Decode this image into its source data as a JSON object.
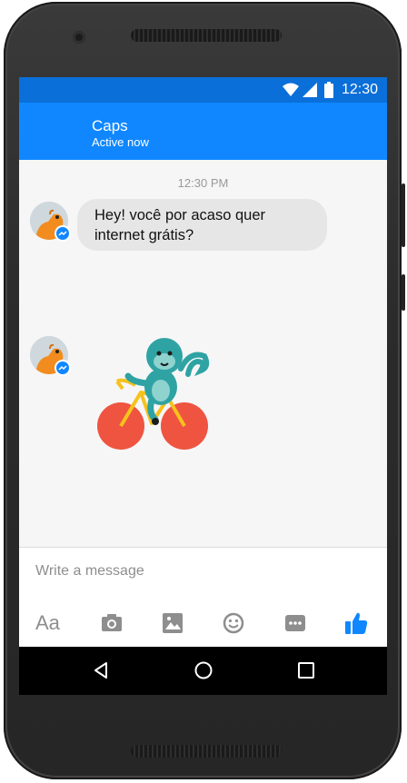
{
  "status_bar": {
    "time": "12:30"
  },
  "chat_header": {
    "contact_name": "Caps",
    "status": "Active now"
  },
  "conversation": {
    "timestamp": "12:30 PM",
    "messages": [
      {
        "type": "text",
        "line1": "Hey! você por acaso quer",
        "line2": "internet grátis?"
      },
      {
        "type": "sticker",
        "sticker": "monkey-riding-bicycle"
      }
    ]
  },
  "composer": {
    "placeholder": "Write a message"
  },
  "toolbar": {
    "text_format_label": "Aa"
  },
  "colors": {
    "brand_blue": "#1087ff",
    "status_blue": "#0a6fd9",
    "bubble_gray": "#e6e6e6"
  }
}
